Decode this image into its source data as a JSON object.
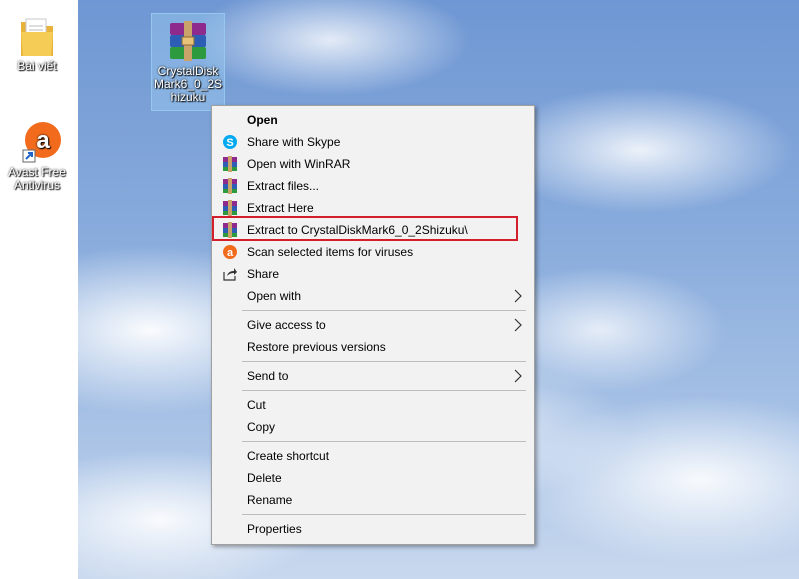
{
  "desktop": {
    "icons": [
      {
        "name": "Bài viết",
        "icon": "folder-icon"
      },
      {
        "name": "Avast Free Antivirus",
        "icon": "avast-icon"
      },
      {
        "name": "CrystalDiskMark6_0_2Shizuku",
        "icon": "winrar-archive-icon"
      }
    ]
  },
  "context_menu": {
    "items": [
      {
        "label": "Open",
        "bold": true
      },
      {
        "label": "Share with Skype",
        "icon": "skype-icon"
      },
      {
        "label": "Open with WinRAR",
        "icon": "winrar-icon"
      },
      {
        "label": "Extract files...",
        "icon": "winrar-icon"
      },
      {
        "label": "Extract Here",
        "icon": "winrar-icon"
      },
      {
        "label": "Extract to CrystalDiskMark6_0_2Shizuku\\",
        "icon": "winrar-icon",
        "highlighted": true
      },
      {
        "label": "Scan selected items for viruses",
        "icon": "avast-icon"
      },
      {
        "label": "Share",
        "icon": "share-icon"
      },
      {
        "label": "Open with",
        "submenu": true
      },
      {
        "label": "Give access to",
        "submenu": true
      },
      {
        "label": "Restore previous versions"
      },
      {
        "label": "Send to",
        "submenu": true
      },
      {
        "label": "Cut"
      },
      {
        "label": "Copy"
      },
      {
        "label": "Create shortcut"
      },
      {
        "label": "Delete"
      },
      {
        "label": "Rename"
      },
      {
        "label": "Properties"
      }
    ]
  },
  "colors": {
    "highlight_border": "#d21f2b",
    "menu_background": "#f2f2f2",
    "selection": "#99c9ef"
  }
}
